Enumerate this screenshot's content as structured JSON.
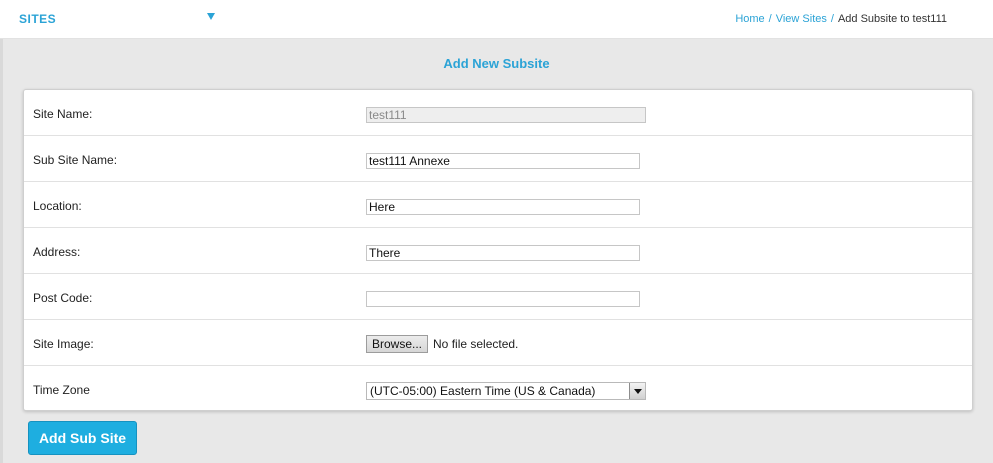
{
  "header": {
    "sites_label": "SITES",
    "caret_icon": "caret-down-icon",
    "breadcrumb": {
      "home": "Home",
      "separator": "/",
      "view_sites": "View Sites",
      "current": "Add Subsite to test111"
    }
  },
  "form": {
    "title": "Add New Subsite",
    "fields": {
      "site_name": {
        "label": "Site Name:",
        "value": "test111"
      },
      "sub_site_name": {
        "label": "Sub Site Name:",
        "value": "test111 Annexe"
      },
      "location": {
        "label": "Location:",
        "value": "Here"
      },
      "address": {
        "label": "Address:",
        "value": "There"
      },
      "post_code": {
        "label": "Post Code:",
        "value": ""
      },
      "site_image": {
        "label": "Site Image:",
        "browse_label": "Browse...",
        "status": "No file selected."
      },
      "time_zone": {
        "label": "Time Zone",
        "selected": "(UTC-05:00) Eastern Time (US & Canada)"
      }
    },
    "submit_label": "Add Sub Site"
  },
  "colors": {
    "accent": "#2ba3d6",
    "button": "#1eaee0",
    "background": "#e8e8e8"
  }
}
